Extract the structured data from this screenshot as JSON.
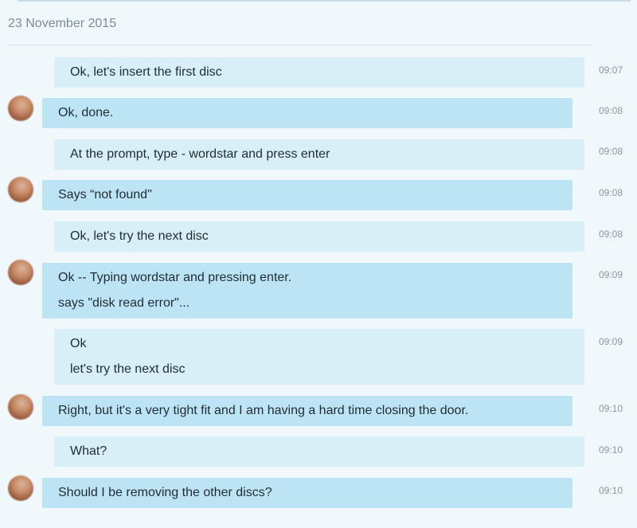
{
  "date_header": "23 November 2015",
  "messages": [
    {
      "direction": "outgoing",
      "lines": [
        "Ok, let's insert the first disc"
      ],
      "time": "09:07"
    },
    {
      "direction": "incoming",
      "lines": [
        "Ok, done."
      ],
      "time": "09:08"
    },
    {
      "direction": "outgoing",
      "lines": [
        "At the prompt, type - wordstar and press enter"
      ],
      "time": "09:08"
    },
    {
      "direction": "incoming",
      "lines": [
        "Says “not found\""
      ],
      "time": "09:08"
    },
    {
      "direction": "outgoing",
      "lines": [
        "Ok, let's try the next disc"
      ],
      "time": "09:08"
    },
    {
      "direction": "incoming",
      "lines": [
        "Ok -- Typing wordstar and pressing enter.",
        "says \"disk read error\"..."
      ],
      "time": "09:09"
    },
    {
      "direction": "outgoing",
      "lines": [
        "Ok",
        "let's try the next disc"
      ],
      "time": "09:09"
    },
    {
      "direction": "incoming",
      "lines": [
        "Right, but it's a very tight fit and I am having a hard time closing the door."
      ],
      "time": "09:10"
    },
    {
      "direction": "outgoing",
      "lines": [
        "What?"
      ],
      "time": "09:10"
    },
    {
      "direction": "incoming",
      "lines": [
        "Should I be removing the other discs?"
      ],
      "time": "09:10"
    }
  ]
}
